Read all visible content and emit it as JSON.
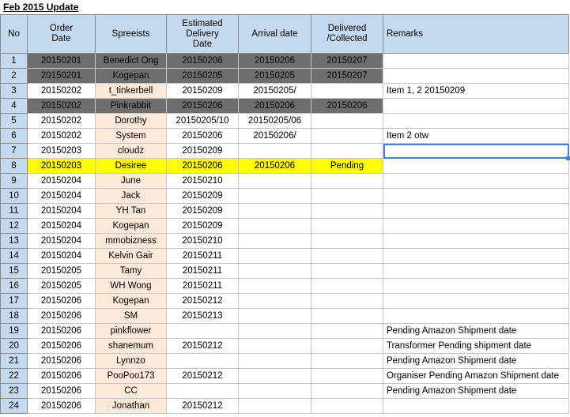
{
  "sheet": {
    "title": "Feb 2015 Update"
  },
  "columns": {
    "no": "No",
    "order_date": "Order\nDate",
    "spreeist": "Spreeists",
    "est_delivery": "Estimated\nDelivery\nDate",
    "arrival": "Arrival date",
    "delivered": "Delivered\n/Collected",
    "remarks": "Remarks"
  },
  "rows": [
    {
      "no": "1",
      "order_date": "20150201",
      "spreeist": "Benedict Ong",
      "est_delivery": "20150206",
      "arrival": "20150206",
      "delivered": "20150207",
      "remarks": "",
      "status": "collected"
    },
    {
      "no": "2",
      "order_date": "20150201",
      "spreeist": "Kogepan",
      "est_delivery": "20150205",
      "arrival": "20150205",
      "delivered": "20150207",
      "remarks": "",
      "status": "collected"
    },
    {
      "no": "3",
      "order_date": "20150202",
      "spreeist": "t_tinkerbell",
      "est_delivery": "20150209",
      "arrival": "20150205/",
      "delivered": "",
      "remarks": "Item 1, 2 20150209",
      "status": ""
    },
    {
      "no": "4",
      "order_date": "20150202",
      "spreeist": "Pinkrabbit",
      "est_delivery": "20150206",
      "arrival": "20150206",
      "delivered": "20150206",
      "remarks": "",
      "status": "collected"
    },
    {
      "no": "5",
      "order_date": "20150202",
      "spreeist": "Dorothy",
      "est_delivery": "20150205/10",
      "arrival": "20150205/06",
      "delivered": "",
      "remarks": "",
      "status": ""
    },
    {
      "no": "6",
      "order_date": "20150202",
      "spreeist": "System",
      "est_delivery": "20150206",
      "arrival": "20150206/",
      "delivered": "",
      "remarks": "Item 2 otw",
      "status": ""
    },
    {
      "no": "7",
      "order_date": "20150203",
      "spreeist": "cloudz",
      "est_delivery": "20150209",
      "arrival": "",
      "delivered": "",
      "remarks": "",
      "status": ""
    },
    {
      "no": "8",
      "order_date": "20150203",
      "spreeist": "Desiree",
      "est_delivery": "20150206",
      "arrival": "20150206",
      "delivered": "Pending",
      "remarks": "",
      "status": "pending"
    },
    {
      "no": "9",
      "order_date": "20150204",
      "spreeist": "June",
      "est_delivery": "20150210",
      "arrival": "",
      "delivered": "",
      "remarks": "",
      "status": ""
    },
    {
      "no": "10",
      "order_date": "20150204",
      "spreeist": "Jack",
      "est_delivery": "20150209",
      "arrival": "",
      "delivered": "",
      "remarks": "",
      "status": ""
    },
    {
      "no": "11",
      "order_date": "20150204",
      "spreeist": "YH Tan",
      "est_delivery": "20150209",
      "arrival": "",
      "delivered": "",
      "remarks": "",
      "status": ""
    },
    {
      "no": "12",
      "order_date": "20150204",
      "spreeist": "Kogepan",
      "est_delivery": "20150209",
      "arrival": "",
      "delivered": "",
      "remarks": "",
      "status": ""
    },
    {
      "no": "13",
      "order_date": "20150204",
      "spreeist": "mmobizness",
      "est_delivery": "20150210",
      "arrival": "",
      "delivered": "",
      "remarks": "",
      "status": ""
    },
    {
      "no": "14",
      "order_date": "20150204",
      "spreeist": "Kelvin Gair",
      "est_delivery": "20150211",
      "arrival": "",
      "delivered": "",
      "remarks": "",
      "status": ""
    },
    {
      "no": "15",
      "order_date": "20150205",
      "spreeist": "Tamy",
      "est_delivery": "20150211",
      "arrival": "",
      "delivered": "",
      "remarks": "",
      "status": ""
    },
    {
      "no": "16",
      "order_date": "20150205",
      "spreeist": "WH Wong",
      "est_delivery": "20150211",
      "arrival": "",
      "delivered": "",
      "remarks": "",
      "status": ""
    },
    {
      "no": "17",
      "order_date": "20150206",
      "spreeist": "Kogepan",
      "est_delivery": "20150212",
      "arrival": "",
      "delivered": "",
      "remarks": "",
      "status": ""
    },
    {
      "no": "18",
      "order_date": "20150206",
      "spreeist": "SM",
      "est_delivery": "20150213",
      "arrival": "",
      "delivered": "",
      "remarks": "",
      "status": ""
    },
    {
      "no": "19",
      "order_date": "20150206",
      "spreeist": "pinkflower",
      "est_delivery": "",
      "arrival": "",
      "delivered": "",
      "remarks": "Pending Amazon Shipment date",
      "status": ""
    },
    {
      "no": "20",
      "order_date": "20150206",
      "spreeist": "shanemum",
      "est_delivery": "20150212",
      "arrival": "",
      "delivered": "",
      "remarks": "Transformer Pending shipment date",
      "status": ""
    },
    {
      "no": "21",
      "order_date": "20150206",
      "spreeist": "Lynnzo",
      "est_delivery": "",
      "arrival": "",
      "delivered": "",
      "remarks": "Pending Amazon Shipment date",
      "status": ""
    },
    {
      "no": "22",
      "order_date": "20150206",
      "spreeist": "PooPoo173",
      "est_delivery": "20150212",
      "arrival": "",
      "delivered": "",
      "remarks": "Organiser Pending Amazon Shipment date",
      "status": ""
    },
    {
      "no": "23",
      "order_date": "20150206",
      "spreeist": "CC",
      "est_delivery": "",
      "arrival": "",
      "delivered": "",
      "remarks": "Pending Amazon Shipment date",
      "status": ""
    },
    {
      "no": "24",
      "order_date": "20150206",
      "spreeist": "Jonathan",
      "est_delivery": "20150212",
      "arrival": "",
      "delivered": "",
      "remarks": "",
      "status": ""
    }
  ],
  "colors": {
    "header_blue": "#c5d9f1",
    "spreeist_peach": "#fde9d9",
    "collected_gray": "#6e6e6e",
    "pending_yellow": "#ffff00",
    "selection_blue": "#4a7fd0"
  }
}
